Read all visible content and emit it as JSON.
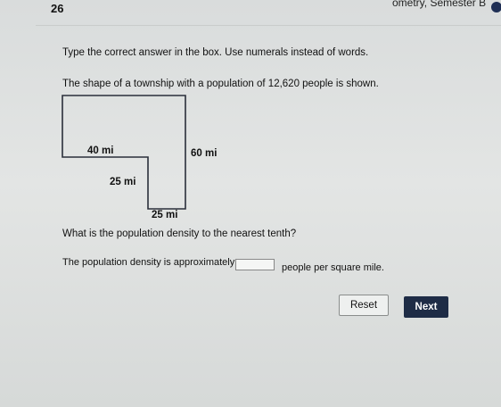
{
  "header": {
    "question_number": "26",
    "course_title": "ometry, Semester B"
  },
  "question": {
    "instructions": "Type the correct answer in the box. Use numerals instead of words.",
    "prompt": "The shape of a township with a population of 12,620 people is shown.",
    "figure": {
      "label_top_left": "40 mi",
      "label_right": "60 mi",
      "label_step": "25 mi",
      "label_bottom": "25 mi"
    },
    "question_text": "What is the population density to the nearest tenth?",
    "answer_lead": "The population density is approximately",
    "answer_value": "",
    "answer_unit": "people per square mile."
  },
  "buttons": {
    "reset": "Reset",
    "next": "Next"
  }
}
